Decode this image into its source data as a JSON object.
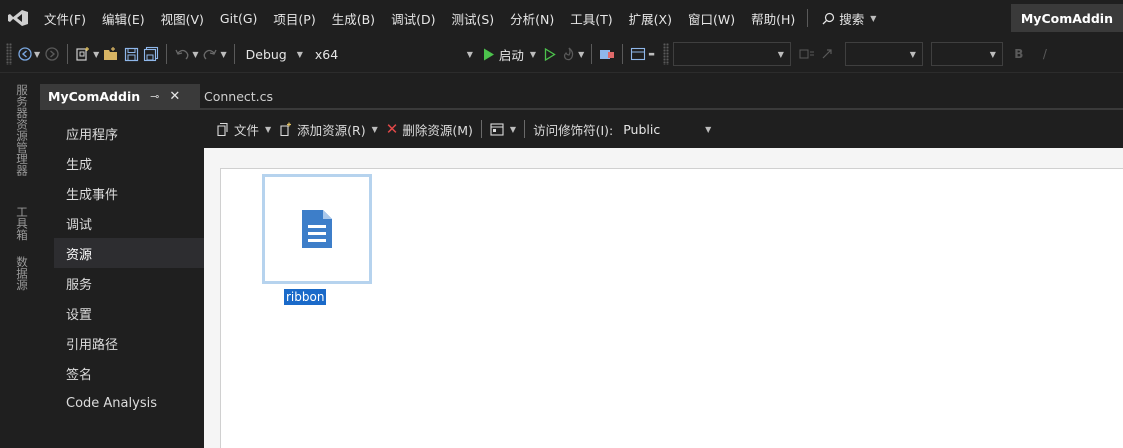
{
  "menubar": {
    "items": [
      "文件(F)",
      "编辑(E)",
      "视图(V)",
      "Git(G)",
      "项目(P)",
      "生成(B)",
      "调试(D)",
      "测试(S)",
      "分析(N)",
      "工具(T)",
      "扩展(X)",
      "窗口(W)",
      "帮助(H)"
    ],
    "search_label": "搜索",
    "solution_name": "MyComAddin"
  },
  "toolbar": {
    "configuration": "Debug",
    "platform": "x64",
    "start_label": "启动",
    "bold_label": "B",
    "italic_label": "/"
  },
  "side_strip": {
    "tabs": [
      "服务器资源管理器",
      "工具箱",
      "数据源"
    ]
  },
  "tabs": {
    "active_label": "MyComAddin",
    "second_label": "Connect.cs"
  },
  "nav": {
    "items": [
      "应用程序",
      "生成",
      "生成事件",
      "调试",
      "资源",
      "服务",
      "设置",
      "引用路径",
      "签名",
      "Code Analysis"
    ],
    "selected_index": 4
  },
  "resource_toolbar": {
    "file_label": "文件",
    "add_label": "添加资源(R)",
    "delete_label": "删除资源(M)",
    "access_label": "访问修饰符(I):",
    "access_value": "Public"
  },
  "resources": {
    "items": [
      {
        "name": "ribbon",
        "icon": "text-file-icon"
      }
    ]
  },
  "colors": {
    "accent": "#1a6ac9",
    "icon_blue": "#3d7ec9",
    "delete_red": "#e04848"
  }
}
